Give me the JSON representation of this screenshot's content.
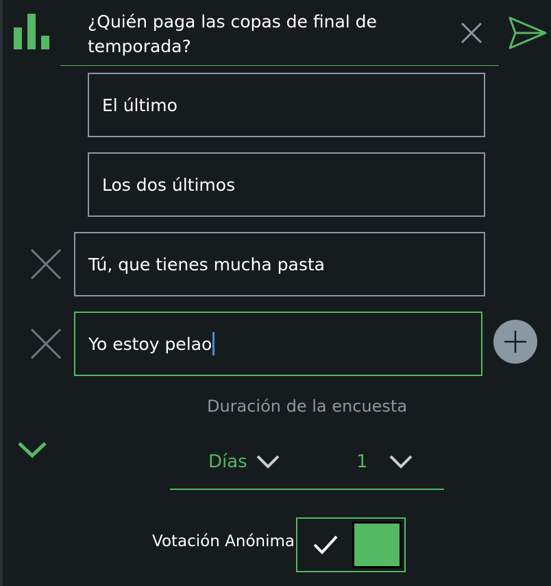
{
  "poll": {
    "question": "¿Quién paga las copas de final de temporada?",
    "options": [
      {
        "value": "El último"
      },
      {
        "value": "Los dos últimos"
      },
      {
        "value": "Tú, que tienes mucha pasta"
      },
      {
        "value": "Yo estoy pelao"
      }
    ]
  },
  "duration": {
    "label": "Duración de la encuesta",
    "unit_selected": "Días",
    "amount_selected": "1"
  },
  "anonymous": {
    "label": "Votación Anónima",
    "enabled": true
  },
  "icons": {
    "poll": "bar-chart-icon",
    "close": "close-icon",
    "send": "send-icon",
    "remove": "remove-option-icon",
    "add": "plus-icon",
    "collapse": "chevron-down-icon",
    "check": "check-icon"
  },
  "colors": {
    "accent": "#55b862",
    "muted": "#8a98a3",
    "background": "#161b1d",
    "cursor": "#4a90e2"
  }
}
